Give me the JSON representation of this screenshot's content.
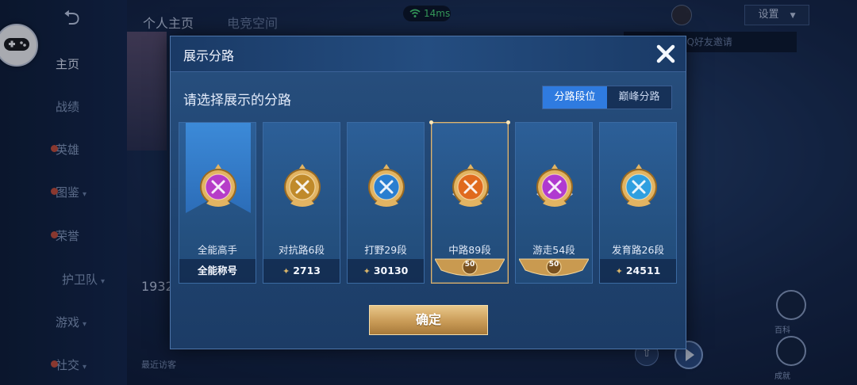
{
  "background": {
    "back_glyph": "⮌",
    "top_tabs": [
      "个人主页",
      "电竞空间"
    ],
    "ping": "14ms",
    "settings_label": "设置",
    "notice": "QQ好友邀请",
    "sidebar_items": [
      {
        "label": "主页",
        "active": true,
        "dot": false,
        "chevron": false
      },
      {
        "label": "战绩",
        "active": false,
        "dot": false,
        "chevron": false
      },
      {
        "label": "英雄",
        "active": false,
        "dot": true,
        "chevron": false
      },
      {
        "label": "图鉴",
        "active": false,
        "dot": true,
        "chevron": true
      },
      {
        "label": "荣誉",
        "active": false,
        "dot": true,
        "chevron": false
      },
      {
        "label": "护卫队",
        "active": false,
        "dot": false,
        "chevron": true
      },
      {
        "label": "游戏",
        "active": false,
        "dot": false,
        "chevron": true
      },
      {
        "label": "社交",
        "active": false,
        "dot": true,
        "chevron": true
      }
    ],
    "id_partial": "1932",
    "recent_visitors": "最近访客",
    "right_icons": [
      "百科",
      "成就"
    ]
  },
  "dialog": {
    "title": "展示分路",
    "prompt": "请选择展示的分路",
    "tabs": [
      {
        "label": "分路段位",
        "active": true
      },
      {
        "label": "巅峰分路",
        "active": false
      }
    ],
    "cards": [
      {
        "label": "全能高手",
        "bottom": "全能称号",
        "icon": "all-round-badge-icon",
        "kind": "title",
        "color": "#b63cc8",
        "highlighted": true
      },
      {
        "label": "对抗路6段",
        "bottom": "2713",
        "icon": "clash-lane-badge-icon",
        "kind": "points",
        "color": "#c08a2a"
      },
      {
        "label": "打野29段",
        "bottom": "30130",
        "icon": "jungle-badge-icon",
        "kind": "points",
        "color": "#2a7ed0"
      },
      {
        "label": "中路89段",
        "bottom": "50",
        "icon": "mid-lane-badge-icon",
        "kind": "level",
        "color": "#e06a1e",
        "selected": true
      },
      {
        "label": "游走54段",
        "bottom": "50",
        "icon": "roam-badge-icon",
        "kind": "level",
        "color": "#b03ad0"
      },
      {
        "label": "发育路26段",
        "bottom": "24511",
        "icon": "farm-lane-badge-icon",
        "kind": "points",
        "color": "#2f9fe0"
      }
    ],
    "confirm_label": "确定"
  },
  "colors": {
    "accent_blue": "#2f7be0",
    "gold": "#d8b46a",
    "selected_border": "#e0b46c"
  }
}
